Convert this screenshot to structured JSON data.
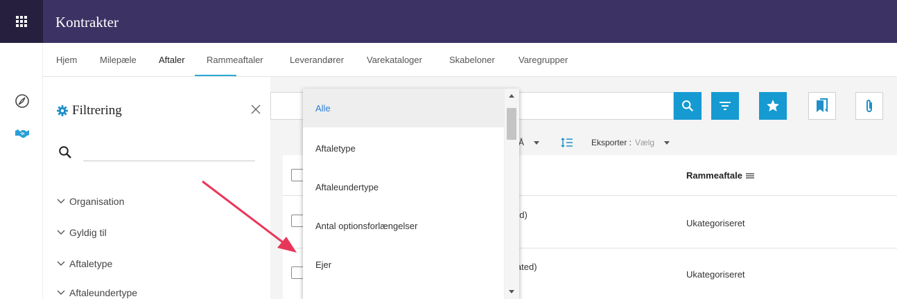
{
  "app": {
    "title": "Kontrakter"
  },
  "nav": {
    "tabs": [
      {
        "label": "Hjem"
      },
      {
        "label": "Milepæle"
      },
      {
        "label": "Aftaler"
      },
      {
        "label": "Rammeaftaler"
      },
      {
        "label": "Leverandører"
      },
      {
        "label": "Varekataloger"
      },
      {
        "label": "Skabeloner"
      },
      {
        "label": "Varegrupper"
      }
    ],
    "active_tab": "Aftaler"
  },
  "filter": {
    "title": "Filtrering",
    "search_value": "",
    "facets": [
      {
        "label": "Organisation"
      },
      {
        "label": "Gyldig til"
      },
      {
        "label": "Aftaletype"
      },
      {
        "label": "Aftaleundertype"
      }
    ]
  },
  "toolbar": {
    "sort_fragment": "Å",
    "export_label": "Eksporter :",
    "export_value": "Vælg"
  },
  "table": {
    "column_header": "Rammeaftale",
    "rows": [
      {
        "fragment": "andard)",
        "rammeaftale": "Ukategoriseret"
      },
      {
        "fragment": "g created)",
        "rammeaftale": "Ukategoriseret"
      }
    ]
  },
  "dropdown": {
    "options": [
      {
        "label": "Alle"
      },
      {
        "label": "Aftaletype"
      },
      {
        "label": "Aftaleundertype"
      },
      {
        "label": "Antal optionsforlængelser"
      },
      {
        "label": "Ejer"
      }
    ],
    "selected": "Alle"
  },
  "colors": {
    "header_bg": "#3d3264",
    "apps_bg": "#26203e",
    "accent_blue": "#159ad1",
    "tab_underline": "#2aa9d5",
    "annotation_arrow": "#e8365a"
  }
}
